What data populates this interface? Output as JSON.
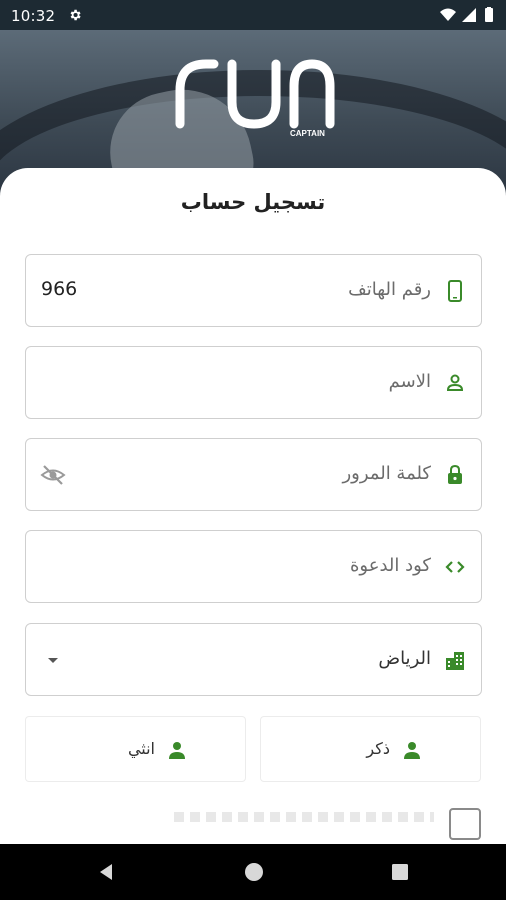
{
  "status_bar": {
    "time": "10:32",
    "icons": [
      "settings-gear-icon",
      "wifi-icon",
      "signal-icon",
      "battery-icon"
    ]
  },
  "brand": {
    "logo_text": "run",
    "logo_subtext": "CAPTAIN"
  },
  "form": {
    "title": "تسجيل حساب",
    "fields": [
      {
        "label": "رقم الهاتف",
        "value": "966",
        "icon": "phone-icon"
      },
      {
        "label": "الاسم",
        "value": "",
        "icon": "person-icon"
      },
      {
        "label": "كلمة المرور",
        "value": "",
        "icon": "lock-icon",
        "trailing_icon": "visibility-off-icon"
      },
      {
        "label": "كود الدعوة",
        "value": "",
        "icon": "code-icon"
      },
      {
        "label": "الرياض",
        "value": "",
        "icon": "city-icon",
        "trailing_icon": "dropdown-arrow-icon"
      }
    ],
    "gender": {
      "male": "ذكر",
      "female": "انثي"
    }
  },
  "colors": {
    "accent_green": "#3a8a2a",
    "status_bar_bg": "#1d2a33",
    "nav_bar_bg": "#000000"
  },
  "nav_bar": {
    "icons": [
      "back-icon",
      "home-icon",
      "recents-icon"
    ]
  }
}
